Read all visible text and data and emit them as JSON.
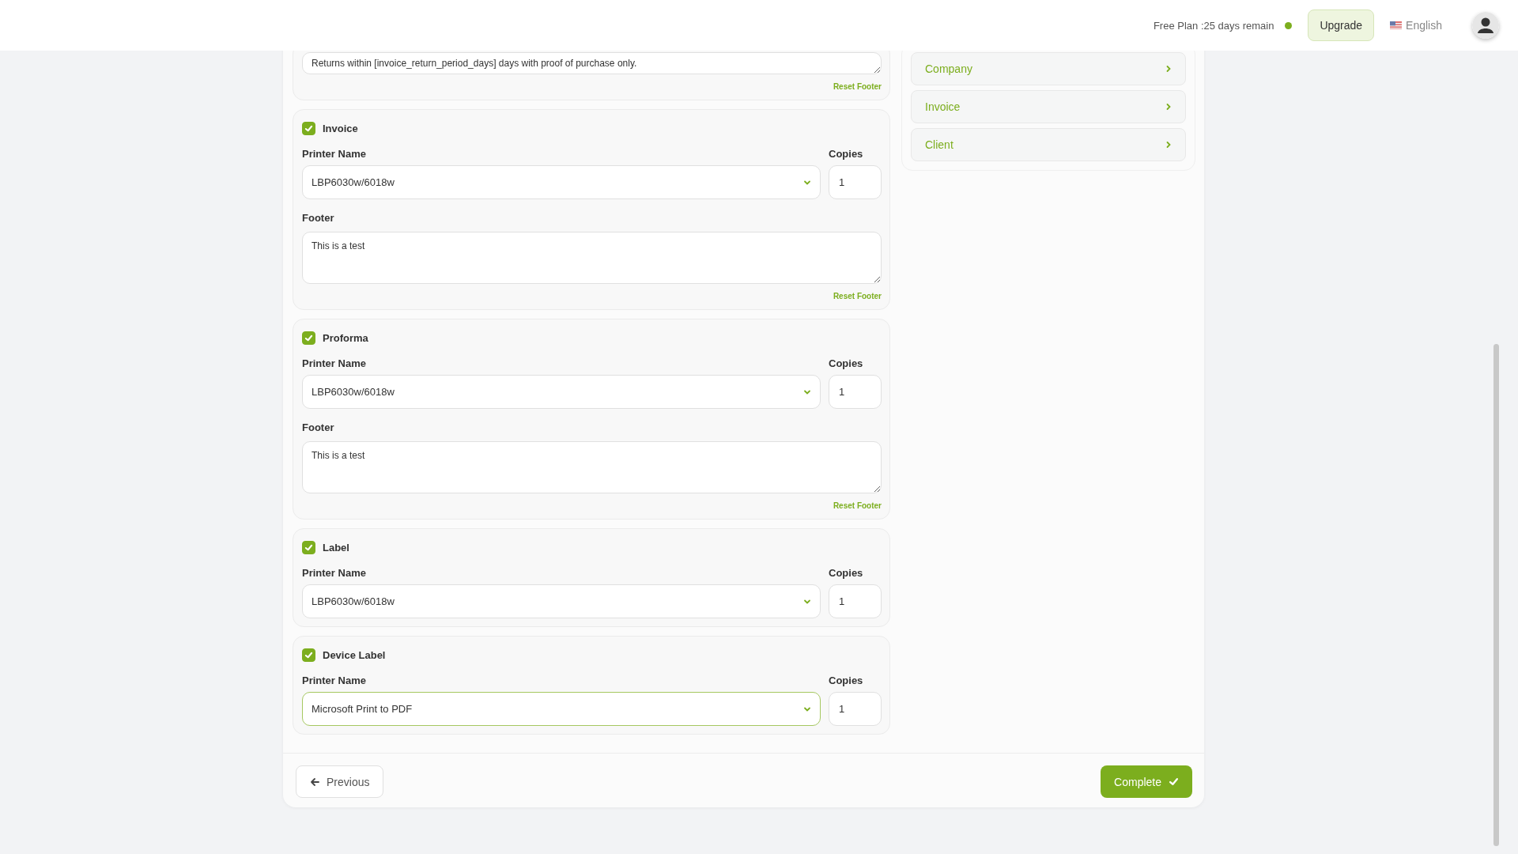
{
  "header": {
    "plan_status": "Free Plan :25 days remain",
    "upgrade": "Upgrade",
    "language": "English"
  },
  "previous_section": {
    "footer": "Returns within [invoice_return_period_days] days with proof of purchase only.",
    "reset_label": "Reset Footer"
  },
  "documents": [
    {
      "title": "Invoice",
      "checked": true,
      "printer_label": "Printer Name",
      "printer": "LBP6030w/6018w",
      "focused": false,
      "copies_label": "Copies",
      "copies": "1",
      "footer_label": "Footer",
      "footer": "This is a test",
      "reset_label": "Reset Footer"
    },
    {
      "title": "Proforma",
      "checked": true,
      "printer_label": "Printer Name",
      "printer": "LBP6030w/6018w",
      "focused": false,
      "copies_label": "Copies",
      "copies": "1",
      "footer_label": "Footer",
      "footer": "This is a test",
      "reset_label": "Reset Footer"
    },
    {
      "title": "Label",
      "checked": true,
      "printer_label": "Printer Name",
      "printer": "LBP6030w/6018w",
      "focused": false,
      "copies_label": "Copies",
      "copies": "1"
    },
    {
      "title": "Device Label",
      "checked": true,
      "printer_label": "Printer Name",
      "printer": "Microsoft Print to PDF",
      "focused": true,
      "copies_label": "Copies",
      "copies": "1"
    }
  ],
  "side_menu": [
    {
      "label": "Company"
    },
    {
      "label": "Invoice"
    },
    {
      "label": "Client"
    }
  ],
  "actions": {
    "previous": "Previous",
    "complete": "Complete"
  }
}
